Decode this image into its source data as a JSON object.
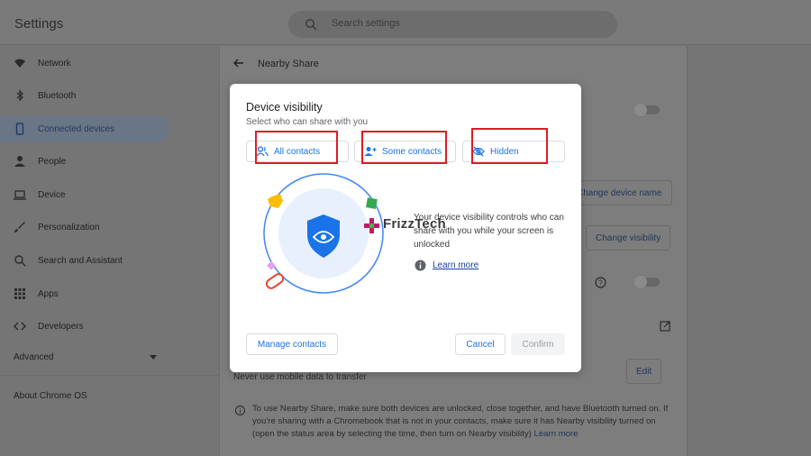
{
  "app": {
    "title": "Settings"
  },
  "search": {
    "placeholder": "Search settings",
    "icon": "search-icon"
  },
  "sidebar": {
    "items": [
      {
        "label": "Network",
        "icon": "wifi-icon"
      },
      {
        "label": "Bluetooth",
        "icon": "bluetooth-icon"
      },
      {
        "label": "Connected devices",
        "icon": "phone-icon",
        "active": true
      },
      {
        "label": "People",
        "icon": "person-icon"
      },
      {
        "label": "Device",
        "icon": "laptop-icon"
      },
      {
        "label": "Personalization",
        "icon": "brush-icon"
      },
      {
        "label": "Search and Assistant",
        "icon": "search-icon"
      },
      {
        "label": "Apps",
        "icon": "apps-grid-icon"
      },
      {
        "label": "Developers",
        "icon": "code-icon"
      }
    ],
    "advanced": "Advanced",
    "about": "About Chrome OS"
  },
  "page": {
    "subpage_title": "Nearby Share",
    "change_device_name": "Change device name",
    "change_visibility": "Change visibility",
    "data_usage_text": "Never use mobile data to transfer",
    "edit": "Edit",
    "info_text": "To use Nearby Share, make sure both devices are unlocked, close together, and have Bluetooth turned on. If you're sharing with a Chromebook that is not in your contacts, make sure it has Nearby visibility turned on (open the status area by selecting the time, then turn on Nearby visibility)",
    "info_link": "Learn more"
  },
  "dialog": {
    "title": "Device visibility",
    "subtitle": "Select who can share with you",
    "options": [
      {
        "label": "All contacts",
        "icon": "contacts-icon"
      },
      {
        "label": "Some contacts",
        "icon": "add-person-icon"
      },
      {
        "label": "Hidden",
        "icon": "eye-off-icon"
      }
    ],
    "description": "Your device visibility controls who can share with you while your screen is unlocked",
    "learn_more": "Learn more",
    "watermark": "FrizzTech",
    "buttons": {
      "manage_contacts": "Manage contacts",
      "cancel": "Cancel",
      "confirm": "Confirm"
    }
  },
  "colors": {
    "accent": "#1a73e8",
    "highlight": "#e01b24",
    "shield": "#1a73e8",
    "overlay": "#757575"
  }
}
